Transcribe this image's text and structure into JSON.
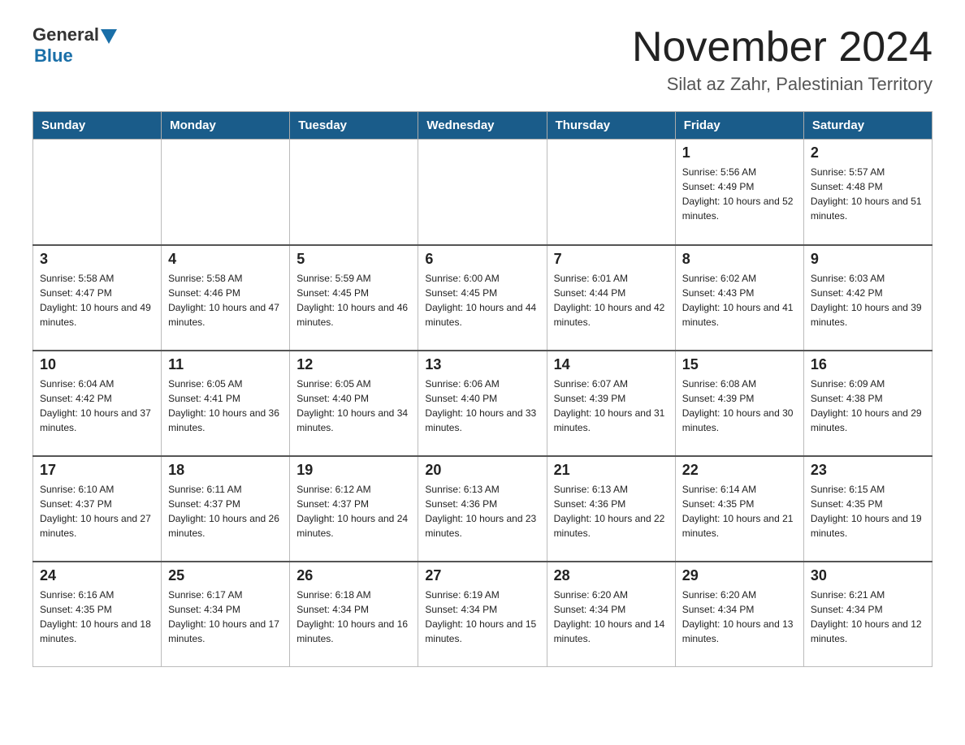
{
  "header": {
    "logo_general": "General",
    "logo_blue": "Blue",
    "title": "November 2024",
    "location": "Silat az Zahr, Palestinian Territory"
  },
  "days_of_week": [
    "Sunday",
    "Monday",
    "Tuesday",
    "Wednesday",
    "Thursday",
    "Friday",
    "Saturday"
  ],
  "weeks": [
    [
      {
        "day": "",
        "info": ""
      },
      {
        "day": "",
        "info": ""
      },
      {
        "day": "",
        "info": ""
      },
      {
        "day": "",
        "info": ""
      },
      {
        "day": "",
        "info": ""
      },
      {
        "day": "1",
        "info": "Sunrise: 5:56 AM\nSunset: 4:49 PM\nDaylight: 10 hours and 52 minutes."
      },
      {
        "day": "2",
        "info": "Sunrise: 5:57 AM\nSunset: 4:48 PM\nDaylight: 10 hours and 51 minutes."
      }
    ],
    [
      {
        "day": "3",
        "info": "Sunrise: 5:58 AM\nSunset: 4:47 PM\nDaylight: 10 hours and 49 minutes."
      },
      {
        "day": "4",
        "info": "Sunrise: 5:58 AM\nSunset: 4:46 PM\nDaylight: 10 hours and 47 minutes."
      },
      {
        "day": "5",
        "info": "Sunrise: 5:59 AM\nSunset: 4:45 PM\nDaylight: 10 hours and 46 minutes."
      },
      {
        "day": "6",
        "info": "Sunrise: 6:00 AM\nSunset: 4:45 PM\nDaylight: 10 hours and 44 minutes."
      },
      {
        "day": "7",
        "info": "Sunrise: 6:01 AM\nSunset: 4:44 PM\nDaylight: 10 hours and 42 minutes."
      },
      {
        "day": "8",
        "info": "Sunrise: 6:02 AM\nSunset: 4:43 PM\nDaylight: 10 hours and 41 minutes."
      },
      {
        "day": "9",
        "info": "Sunrise: 6:03 AM\nSunset: 4:42 PM\nDaylight: 10 hours and 39 minutes."
      }
    ],
    [
      {
        "day": "10",
        "info": "Sunrise: 6:04 AM\nSunset: 4:42 PM\nDaylight: 10 hours and 37 minutes."
      },
      {
        "day": "11",
        "info": "Sunrise: 6:05 AM\nSunset: 4:41 PM\nDaylight: 10 hours and 36 minutes."
      },
      {
        "day": "12",
        "info": "Sunrise: 6:05 AM\nSunset: 4:40 PM\nDaylight: 10 hours and 34 minutes."
      },
      {
        "day": "13",
        "info": "Sunrise: 6:06 AM\nSunset: 4:40 PM\nDaylight: 10 hours and 33 minutes."
      },
      {
        "day": "14",
        "info": "Sunrise: 6:07 AM\nSunset: 4:39 PM\nDaylight: 10 hours and 31 minutes."
      },
      {
        "day": "15",
        "info": "Sunrise: 6:08 AM\nSunset: 4:39 PM\nDaylight: 10 hours and 30 minutes."
      },
      {
        "day": "16",
        "info": "Sunrise: 6:09 AM\nSunset: 4:38 PM\nDaylight: 10 hours and 29 minutes."
      }
    ],
    [
      {
        "day": "17",
        "info": "Sunrise: 6:10 AM\nSunset: 4:37 PM\nDaylight: 10 hours and 27 minutes."
      },
      {
        "day": "18",
        "info": "Sunrise: 6:11 AM\nSunset: 4:37 PM\nDaylight: 10 hours and 26 minutes."
      },
      {
        "day": "19",
        "info": "Sunrise: 6:12 AM\nSunset: 4:37 PM\nDaylight: 10 hours and 24 minutes."
      },
      {
        "day": "20",
        "info": "Sunrise: 6:13 AM\nSunset: 4:36 PM\nDaylight: 10 hours and 23 minutes."
      },
      {
        "day": "21",
        "info": "Sunrise: 6:13 AM\nSunset: 4:36 PM\nDaylight: 10 hours and 22 minutes."
      },
      {
        "day": "22",
        "info": "Sunrise: 6:14 AM\nSunset: 4:35 PM\nDaylight: 10 hours and 21 minutes."
      },
      {
        "day": "23",
        "info": "Sunrise: 6:15 AM\nSunset: 4:35 PM\nDaylight: 10 hours and 19 minutes."
      }
    ],
    [
      {
        "day": "24",
        "info": "Sunrise: 6:16 AM\nSunset: 4:35 PM\nDaylight: 10 hours and 18 minutes."
      },
      {
        "day": "25",
        "info": "Sunrise: 6:17 AM\nSunset: 4:34 PM\nDaylight: 10 hours and 17 minutes."
      },
      {
        "day": "26",
        "info": "Sunrise: 6:18 AM\nSunset: 4:34 PM\nDaylight: 10 hours and 16 minutes."
      },
      {
        "day": "27",
        "info": "Sunrise: 6:19 AM\nSunset: 4:34 PM\nDaylight: 10 hours and 15 minutes."
      },
      {
        "day": "28",
        "info": "Sunrise: 6:20 AM\nSunset: 4:34 PM\nDaylight: 10 hours and 14 minutes."
      },
      {
        "day": "29",
        "info": "Sunrise: 6:20 AM\nSunset: 4:34 PM\nDaylight: 10 hours and 13 minutes."
      },
      {
        "day": "30",
        "info": "Sunrise: 6:21 AM\nSunset: 4:34 PM\nDaylight: 10 hours and 12 minutes."
      }
    ]
  ]
}
